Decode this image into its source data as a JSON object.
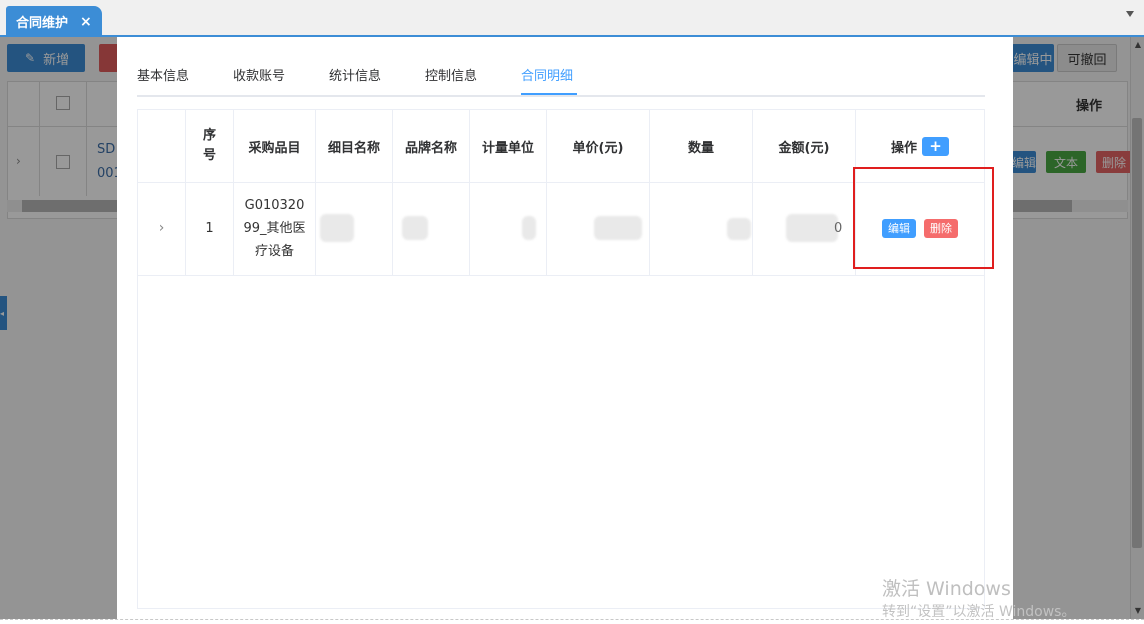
{
  "tabbar": {
    "active_tab": "合同维护",
    "close_symbol": "×"
  },
  "background": {
    "add_button": "新增",
    "editing_button": "编辑中",
    "revoke_button": "可撤回",
    "operation_header": "操作",
    "row_code_1": "SD",
    "row_code_2": "001",
    "tag_edit": "编辑",
    "tag_text": "文本",
    "tag_delete": "删除"
  },
  "modal": {
    "tabs": [
      {
        "label": "基本信息"
      },
      {
        "label": "收款账号"
      },
      {
        "label": "统计信息"
      },
      {
        "label": "控制信息"
      },
      {
        "label": "合同明细",
        "active": true
      }
    ],
    "table": {
      "headers": {
        "seq": "序号",
        "item": "采购品目",
        "detail_name": "细目名称",
        "brand": "品牌名称",
        "unit": "计量单位",
        "price": "单价(元)",
        "qty": "数量",
        "amount": "金额(元)",
        "operation": "操作"
      },
      "add_symbol": "+",
      "rows": [
        {
          "expand": "›",
          "seq": "1",
          "item": "G01032099_其他医疗设备",
          "amount_tail": "0",
          "edit_label": "编辑",
          "delete_label": "删除"
        }
      ]
    }
  },
  "watermark": {
    "title": "激活 Windows",
    "subtitle": "转到“设置”以激活 Windows。"
  },
  "colors": {
    "primary": "#409eff",
    "danger": "#f56c6c",
    "highlight": "#e01e1e",
    "tab_blue": "#3c8dd6"
  }
}
